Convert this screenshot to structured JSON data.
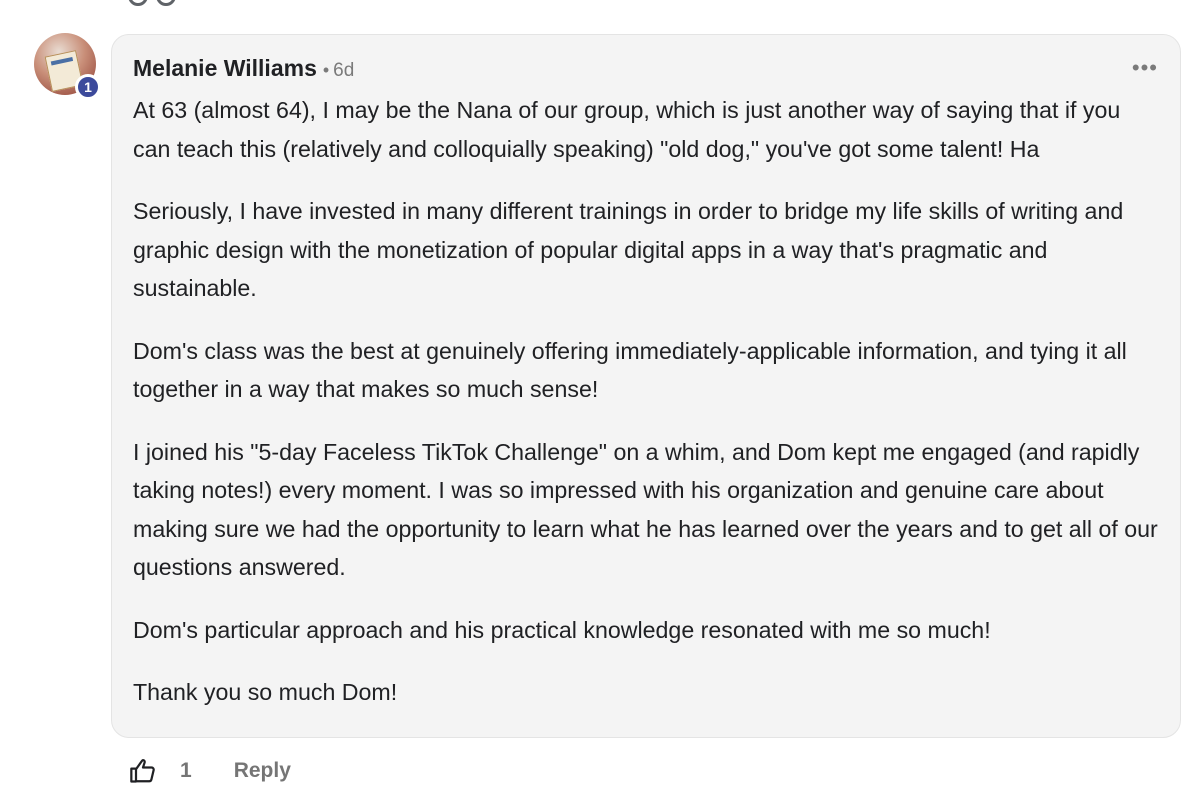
{
  "comment": {
    "author": "Melanie Williams",
    "separator": "•",
    "time": "6d",
    "avatar_badge": "1",
    "more_label": "•••",
    "paragraphs": [
      "At 63 (almost 64), I may be the Nana of our group, which is just another way of saying that if you can teach this (relatively and colloquially speaking) \"old dog,\" you've got some talent! Ha",
      "Seriously, I have invested in many different trainings in order to bridge my life skills of writing and graphic design with the monetization of popular digital apps in a way that's pragmatic and sustainable.",
      "Dom's class was the best at genuinely offering immediately-applicable information, and tying it all together in a way that makes so much sense!",
      "I joined his \"5-day Faceless TikTok Challenge\" on a whim, and Dom kept me engaged (and rapidly taking notes!) every moment. I was so impressed with his organization and genuine care about making sure we had the opportunity to learn what he has learned over the years and to get all of our questions answered.",
      "Dom's particular approach and his practical knowledge resonated with me so much!",
      "Thank you so much Dom!"
    ],
    "like_count": "1",
    "reply_label": "Reply"
  },
  "icons": {
    "like": "thumbs-up-icon",
    "more": "more-horizontal-icon"
  },
  "colors": {
    "badge": "#3c4a9b",
    "bubble": "#f4f4f4",
    "muted_text": "#757575"
  }
}
